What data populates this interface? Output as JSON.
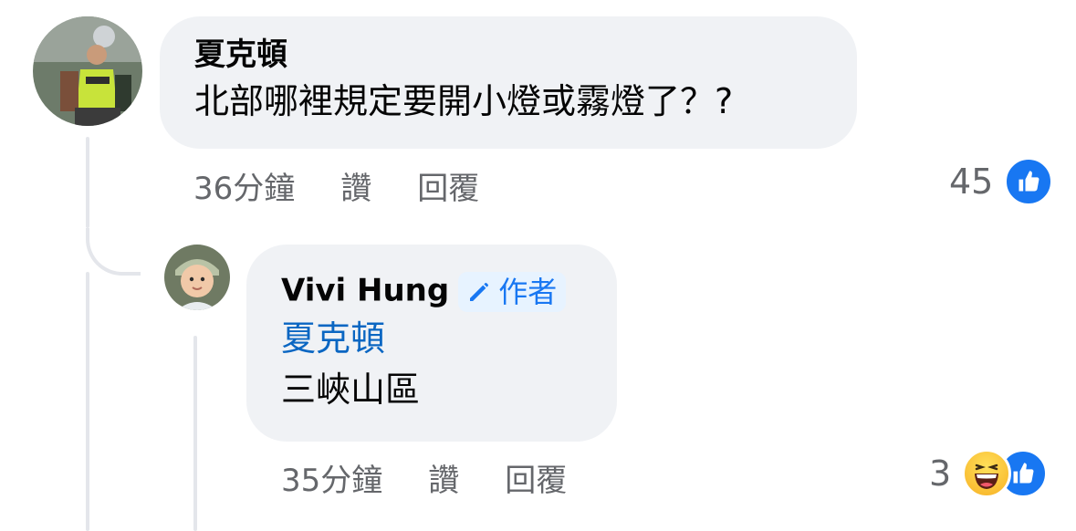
{
  "comment": {
    "author": "夏克頓",
    "text": "北部哪裡規定要開小燈或霧燈了？?",
    "time": "36分鐘",
    "like_label": "讚",
    "reply_label": "回覆",
    "reaction_count": "45",
    "reaction_icons": [
      "like-icon"
    ]
  },
  "reply": {
    "author": "Vivi Hung",
    "author_badge": "作者",
    "mention": "夏克頓",
    "text": "三峽山區",
    "time": "35分鐘",
    "like_label": "讚",
    "reply_label": "回覆",
    "reaction_count": "3",
    "reaction_icons": [
      "haha-icon",
      "like-icon"
    ]
  },
  "colors": {
    "bubble": "#f0f2f5",
    "link": "#0a66c2",
    "accent": "#1877f2",
    "meta": "#65676b"
  }
}
